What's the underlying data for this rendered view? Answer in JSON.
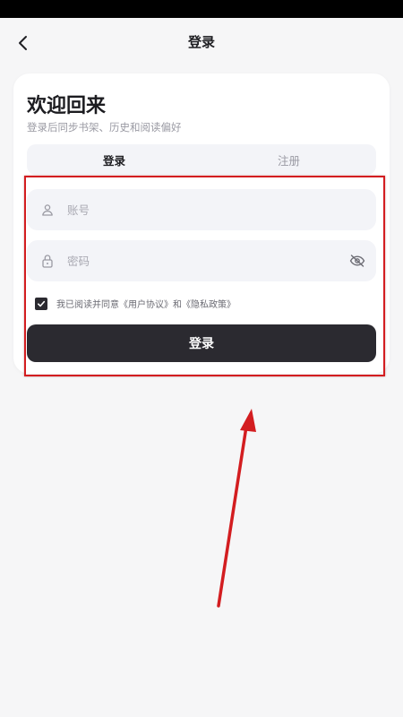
{
  "nav": {
    "title": "登录"
  },
  "card": {
    "title": "欢迎回来",
    "subtitle": "登录后同步书架、历史和阅读偏好",
    "tabs": [
      {
        "label": "登录"
      },
      {
        "label": "注册"
      }
    ]
  },
  "form": {
    "account_placeholder": "账号",
    "password_placeholder": "密码",
    "agree_checked": true,
    "agree_text": "我已阅读并同意《用户协议》和《隐私政策》",
    "submit_label": "登录"
  },
  "colors": {
    "accent": "#2b2a30",
    "annotation": "#d31d20",
    "background": "#f6f6f7"
  },
  "icons": {
    "back": "chevron-left-icon",
    "account": "user-icon",
    "password": "lock-icon",
    "visibility": "eye-off-icon",
    "checkbox": "check-icon"
  }
}
